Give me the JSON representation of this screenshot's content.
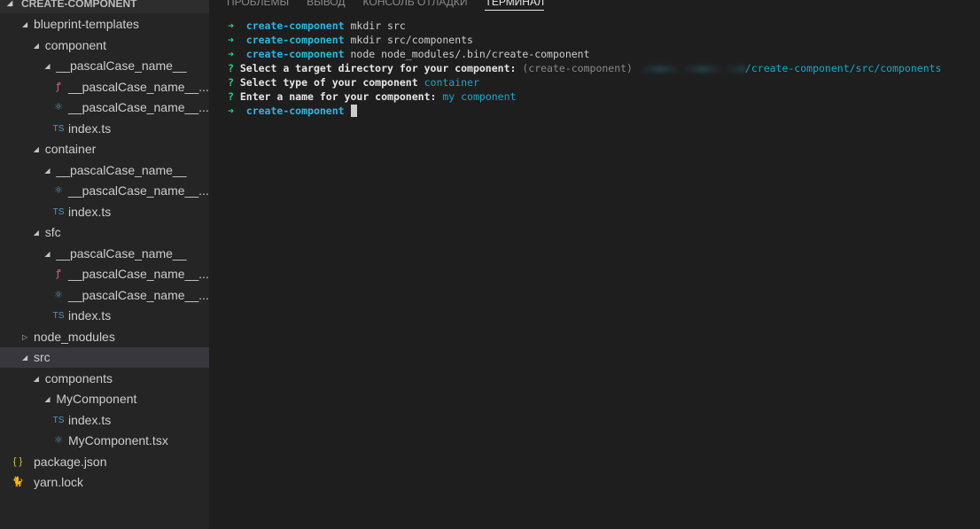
{
  "explorer": {
    "title": "CREATE-COMPONENT",
    "items": [
      {
        "label": "blueprint-templates",
        "level": 0,
        "type": "folder",
        "open": true
      },
      {
        "label": "component",
        "level": 1,
        "type": "folder",
        "open": true
      },
      {
        "label": "__pascalCase_name__",
        "level": 2,
        "type": "folder",
        "open": true
      },
      {
        "label": "__pascalCase_name__....",
        "level": 3,
        "type": "file",
        "icon": "sass-icon"
      },
      {
        "label": "__pascalCase_name__....",
        "level": 3,
        "type": "file",
        "icon": "react-icon"
      },
      {
        "label": "index.ts",
        "level": 3,
        "type": "file",
        "icon": "typescript-icon"
      },
      {
        "label": "container",
        "level": 1,
        "type": "folder",
        "open": true
      },
      {
        "label": "__pascalCase_name__",
        "level": 2,
        "type": "folder",
        "open": true
      },
      {
        "label": "__pascalCase_name__....",
        "level": 3,
        "type": "file",
        "icon": "react-icon"
      },
      {
        "label": "index.ts",
        "level": 3,
        "type": "file",
        "icon": "typescript-icon"
      },
      {
        "label": "sfc",
        "level": 1,
        "type": "folder",
        "open": true
      },
      {
        "label": "__pascalCase_name__",
        "level": 2,
        "type": "folder",
        "open": true
      },
      {
        "label": "__pascalCase_name__....",
        "level": 3,
        "type": "file",
        "icon": "sass-icon"
      },
      {
        "label": "__pascalCase_name__....",
        "level": 3,
        "type": "file",
        "icon": "react-icon"
      },
      {
        "label": "index.ts",
        "level": 3,
        "type": "file",
        "icon": "typescript-icon"
      },
      {
        "label": "node_modules",
        "level": 0,
        "type": "folder",
        "open": false
      },
      {
        "label": "src",
        "level": 0,
        "type": "folder",
        "open": true,
        "selected": true
      },
      {
        "label": "components",
        "level": 1,
        "type": "folder",
        "open": true
      },
      {
        "label": "MyComponent",
        "level": 2,
        "type": "folder",
        "open": true
      },
      {
        "label": "index.ts",
        "level": 3,
        "type": "file",
        "icon": "typescript-icon"
      },
      {
        "label": "MyComponent.tsx",
        "level": 3,
        "type": "file",
        "icon": "react-icon"
      },
      {
        "label": "package.json",
        "level": 0,
        "type": "file",
        "icon": "json-icon"
      },
      {
        "label": "yarn.lock",
        "level": 0,
        "type": "file",
        "icon": "yarn-icon"
      }
    ]
  },
  "panel": {
    "tabs": [
      "ПРОБЛЕМЫ",
      "ВЫВОД",
      "КОНСОЛЬ ОТЛАДКИ",
      "ТЕРМИНАЛ"
    ],
    "active_tab": "ТЕРМИНАЛ"
  },
  "terminal": {
    "prompt": "create-component",
    "cmd1": "mkdir src",
    "cmd2": "mkdir src/components",
    "cmd3": "node node_modules/.bin/create-component",
    "q1": "Select a target directory for your component:",
    "q1_hint": "(create-component)",
    "q1_answer": "/create-component/src/components",
    "q2": "Select type of your component",
    "q2_answer": "container",
    "q3": "Enter a name for your component:",
    "q3_answer": "my component"
  }
}
